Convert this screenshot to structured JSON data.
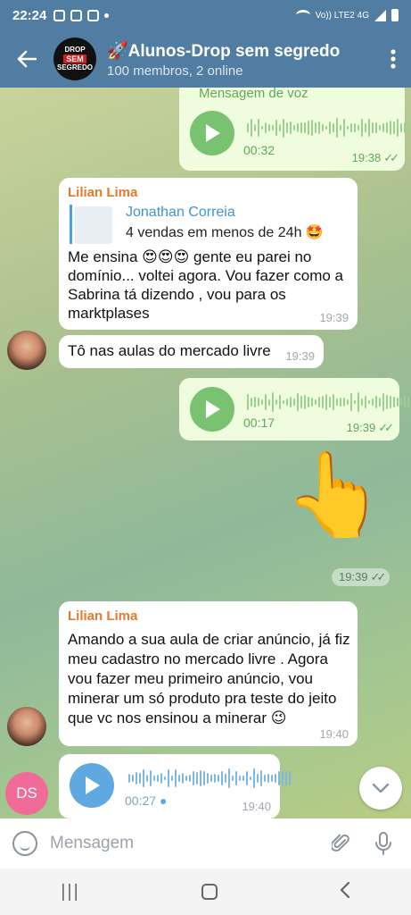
{
  "status_bar": {
    "time": "22:24",
    "network": "Vo)) LTE2 4G"
  },
  "header": {
    "title": "🚀Alunos-Drop sem segredo",
    "subtitle": "100 membros, 2 online",
    "avatar_lines": [
      "DROP",
      "SEM",
      "SEGREDO"
    ]
  },
  "messages": {
    "voice_top": {
      "label": "Mensagem de voz",
      "duration": "00:32",
      "time": "19:38"
    },
    "lilian_reply": {
      "sender": "Lilian Lima",
      "reply_to_name": "Jonathan Correia",
      "reply_to_text": "4 vendas em menos de 24h 🤩",
      "text": "Me ensina 😍😍😍 gente eu parei no domínio... voltei agora. Vou fazer como a Sabrina tá dizendo , vou para os marktplases",
      "time": "19:39"
    },
    "lilian_short": {
      "text": "Tô nas aulas do mercado livre",
      "time": "19:39"
    },
    "voice_mid": {
      "duration": "00:17",
      "time": "19:39"
    },
    "sticker": {
      "emoji": "👆",
      "time": "19:39"
    },
    "lilian_long": {
      "sender": "Lilian Lima",
      "text": "Amando  a sua aula de criar anúncio, já fiz meu cadastro no mercado livre . Agora vou fazer meu primeiro anúncio, vou minerar um só produto pra teste do jeito que vc nos ensinou a minerar 😉",
      "time": "19:40"
    },
    "voice_ds": {
      "avatar_initials": "DS",
      "duration": "00:27",
      "time": "19:40"
    }
  },
  "input": {
    "placeholder": "Mensagem"
  },
  "colors": {
    "header": "#517da2",
    "outgoing": "#effdde",
    "incoming": "#ffffff",
    "accent_name": "#e07a2e",
    "reply_name": "#3d94d6"
  }
}
